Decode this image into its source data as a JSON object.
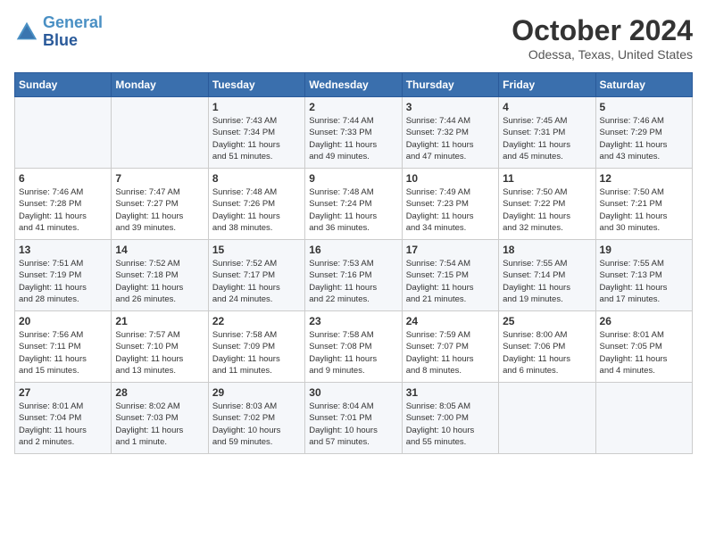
{
  "header": {
    "logo_line1": "General",
    "logo_line2": "Blue",
    "month": "October 2024",
    "location": "Odessa, Texas, United States"
  },
  "weekdays": [
    "Sunday",
    "Monday",
    "Tuesday",
    "Wednesday",
    "Thursday",
    "Friday",
    "Saturday"
  ],
  "weeks": [
    [
      {
        "day": "",
        "detail": ""
      },
      {
        "day": "",
        "detail": ""
      },
      {
        "day": "1",
        "detail": "Sunrise: 7:43 AM\nSunset: 7:34 PM\nDaylight: 11 hours\nand 51 minutes."
      },
      {
        "day": "2",
        "detail": "Sunrise: 7:44 AM\nSunset: 7:33 PM\nDaylight: 11 hours\nand 49 minutes."
      },
      {
        "day": "3",
        "detail": "Sunrise: 7:44 AM\nSunset: 7:32 PM\nDaylight: 11 hours\nand 47 minutes."
      },
      {
        "day": "4",
        "detail": "Sunrise: 7:45 AM\nSunset: 7:31 PM\nDaylight: 11 hours\nand 45 minutes."
      },
      {
        "day": "5",
        "detail": "Sunrise: 7:46 AM\nSunset: 7:29 PM\nDaylight: 11 hours\nand 43 minutes."
      }
    ],
    [
      {
        "day": "6",
        "detail": "Sunrise: 7:46 AM\nSunset: 7:28 PM\nDaylight: 11 hours\nand 41 minutes."
      },
      {
        "day": "7",
        "detail": "Sunrise: 7:47 AM\nSunset: 7:27 PM\nDaylight: 11 hours\nand 39 minutes."
      },
      {
        "day": "8",
        "detail": "Sunrise: 7:48 AM\nSunset: 7:26 PM\nDaylight: 11 hours\nand 38 minutes."
      },
      {
        "day": "9",
        "detail": "Sunrise: 7:48 AM\nSunset: 7:24 PM\nDaylight: 11 hours\nand 36 minutes."
      },
      {
        "day": "10",
        "detail": "Sunrise: 7:49 AM\nSunset: 7:23 PM\nDaylight: 11 hours\nand 34 minutes."
      },
      {
        "day": "11",
        "detail": "Sunrise: 7:50 AM\nSunset: 7:22 PM\nDaylight: 11 hours\nand 32 minutes."
      },
      {
        "day": "12",
        "detail": "Sunrise: 7:50 AM\nSunset: 7:21 PM\nDaylight: 11 hours\nand 30 minutes."
      }
    ],
    [
      {
        "day": "13",
        "detail": "Sunrise: 7:51 AM\nSunset: 7:19 PM\nDaylight: 11 hours\nand 28 minutes."
      },
      {
        "day": "14",
        "detail": "Sunrise: 7:52 AM\nSunset: 7:18 PM\nDaylight: 11 hours\nand 26 minutes."
      },
      {
        "day": "15",
        "detail": "Sunrise: 7:52 AM\nSunset: 7:17 PM\nDaylight: 11 hours\nand 24 minutes."
      },
      {
        "day": "16",
        "detail": "Sunrise: 7:53 AM\nSunset: 7:16 PM\nDaylight: 11 hours\nand 22 minutes."
      },
      {
        "day": "17",
        "detail": "Sunrise: 7:54 AM\nSunset: 7:15 PM\nDaylight: 11 hours\nand 21 minutes."
      },
      {
        "day": "18",
        "detail": "Sunrise: 7:55 AM\nSunset: 7:14 PM\nDaylight: 11 hours\nand 19 minutes."
      },
      {
        "day": "19",
        "detail": "Sunrise: 7:55 AM\nSunset: 7:13 PM\nDaylight: 11 hours\nand 17 minutes."
      }
    ],
    [
      {
        "day": "20",
        "detail": "Sunrise: 7:56 AM\nSunset: 7:11 PM\nDaylight: 11 hours\nand 15 minutes."
      },
      {
        "day": "21",
        "detail": "Sunrise: 7:57 AM\nSunset: 7:10 PM\nDaylight: 11 hours\nand 13 minutes."
      },
      {
        "day": "22",
        "detail": "Sunrise: 7:58 AM\nSunset: 7:09 PM\nDaylight: 11 hours\nand 11 minutes."
      },
      {
        "day": "23",
        "detail": "Sunrise: 7:58 AM\nSunset: 7:08 PM\nDaylight: 11 hours\nand 9 minutes."
      },
      {
        "day": "24",
        "detail": "Sunrise: 7:59 AM\nSunset: 7:07 PM\nDaylight: 11 hours\nand 8 minutes."
      },
      {
        "day": "25",
        "detail": "Sunrise: 8:00 AM\nSunset: 7:06 PM\nDaylight: 11 hours\nand 6 minutes."
      },
      {
        "day": "26",
        "detail": "Sunrise: 8:01 AM\nSunset: 7:05 PM\nDaylight: 11 hours\nand 4 minutes."
      }
    ],
    [
      {
        "day": "27",
        "detail": "Sunrise: 8:01 AM\nSunset: 7:04 PM\nDaylight: 11 hours\nand 2 minutes."
      },
      {
        "day": "28",
        "detail": "Sunrise: 8:02 AM\nSunset: 7:03 PM\nDaylight: 11 hours\nand 1 minute."
      },
      {
        "day": "29",
        "detail": "Sunrise: 8:03 AM\nSunset: 7:02 PM\nDaylight: 10 hours\nand 59 minutes."
      },
      {
        "day": "30",
        "detail": "Sunrise: 8:04 AM\nSunset: 7:01 PM\nDaylight: 10 hours\nand 57 minutes."
      },
      {
        "day": "31",
        "detail": "Sunrise: 8:05 AM\nSunset: 7:00 PM\nDaylight: 10 hours\nand 55 minutes."
      },
      {
        "day": "",
        "detail": ""
      },
      {
        "day": "",
        "detail": ""
      }
    ]
  ]
}
